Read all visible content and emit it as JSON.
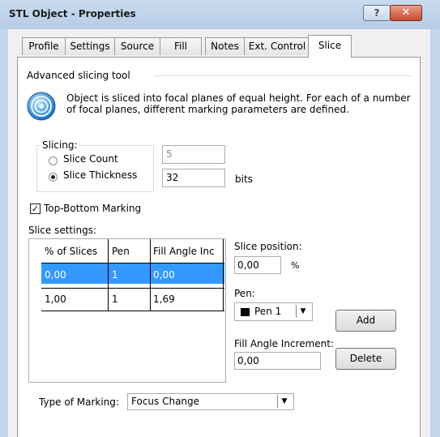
{
  "window": {
    "title": "STL Object - Properties",
    "help_glyph": "?",
    "close_glyph": "✕"
  },
  "tabs": [
    "Profile",
    "Settings",
    "Source",
    "Fill",
    "Notes",
    "Ext. Control",
    "Slice"
  ],
  "active_tab": "Slice",
  "advanced": {
    "heading": "Advanced slicing tool",
    "description_line1": "Object is sliced into focal planes of equal height. For each of a number",
    "description_line2": "of focal planes, different marking parameters are defined."
  },
  "slicing": {
    "legend": "Slicing:",
    "slice_count_label": "Slice Count",
    "slice_count_value": "5",
    "slice_thickness_label": "Slice Thickness",
    "slice_thickness_value": "32",
    "unit": "bits",
    "selected": "Slice Thickness"
  },
  "top_bottom": {
    "label": "Top-Bottom Marking",
    "checked": true
  },
  "slice_settings": {
    "label": "Slice settings:",
    "columns": [
      "% of Slices",
      "Pen",
      "Fill Angle Inc"
    ],
    "rows": [
      [
        "0,00",
        "1",
        "0,00"
      ],
      [
        "1,00",
        "1",
        "1,69"
      ]
    ],
    "selected_row": 0
  },
  "slice_position": {
    "label": "Slice position:",
    "value": "0,00",
    "unit": "%"
  },
  "pen": {
    "label": "Pen:",
    "value": "Pen 1",
    "swatch_color": "#000000"
  },
  "fill_angle": {
    "label": "Fill Angle Increment:",
    "value": "0,00"
  },
  "buttons": {
    "add": "Add",
    "delete": "Delete"
  },
  "marking": {
    "label": "Type of Marking:",
    "value": "Focus Change"
  },
  "colors": {
    "selection": "#3399ff",
    "panel_border": "#9a9a9a"
  }
}
